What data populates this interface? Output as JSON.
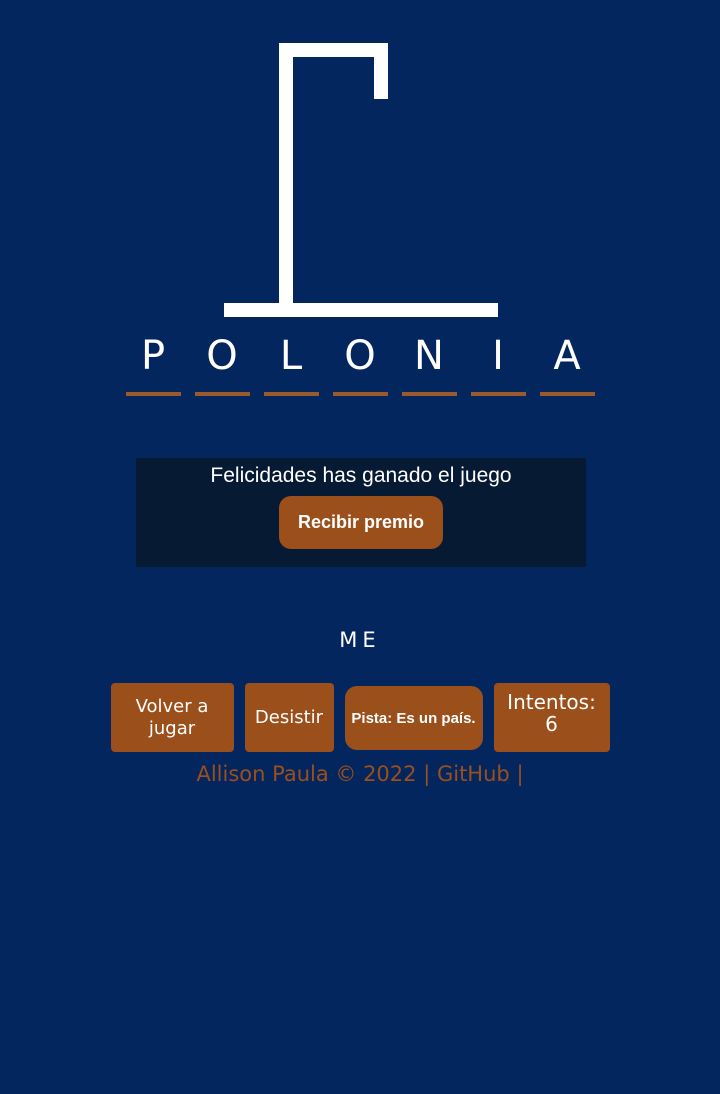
{
  "word": {
    "letters": [
      "P",
      "O",
      "L",
      "O",
      "N",
      "I",
      "A"
    ]
  },
  "win_panel": {
    "message": "Felicidades has ganado el juego",
    "prize_button": "Recibir premio"
  },
  "wrong_letters": "ME",
  "controls": {
    "play_again": "Volver a jugar",
    "give_up": "Desistir",
    "hint": "Pista: Es un país.",
    "attempts_label": "Intentos:",
    "attempts_value": "6"
  },
  "footer": {
    "author": "Allison Paula © 2022",
    "separator": "|",
    "github": "GitHub",
    "trailing": "|"
  },
  "colors": {
    "background": "#03265f",
    "accent": "#9b4f1b",
    "panel": "#061a33",
    "gallows": "#ffffff"
  }
}
